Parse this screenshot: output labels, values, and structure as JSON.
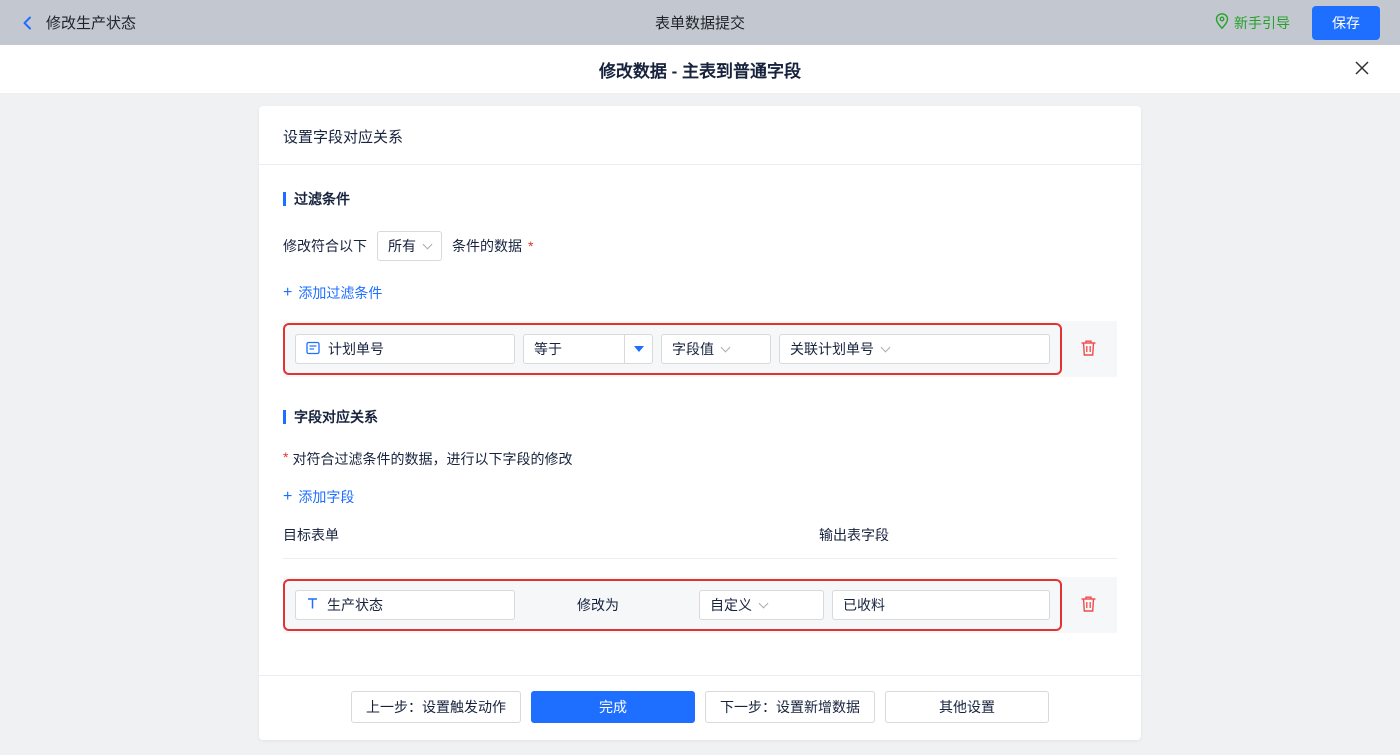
{
  "icons": {
    "plus": "+",
    "required": "*"
  },
  "topbar": {
    "back_label": "修改生产状态",
    "title": "表单数据提交",
    "guide": "新手引导",
    "save": "保存"
  },
  "dialog": {
    "title": "修改数据 - 主表到普通字段"
  },
  "panel": {
    "header": "设置字段对应关系",
    "filter": {
      "title": "过滤条件",
      "prefix": "修改符合以下",
      "match_mode": "所有",
      "suffix": "条件的数据",
      "add": "添加过滤条件",
      "row": {
        "field": "计划单号",
        "operator": "等于",
        "value_type": "字段值",
        "value": "关联计划单号"
      }
    },
    "mapping": {
      "title": "字段对应关系",
      "hint": "对符合过滤条件的数据，进行以下字段的修改",
      "add": "添加字段",
      "columns": {
        "target": "目标表单",
        "output": "输出表字段"
      },
      "row": {
        "field": "生产状态",
        "action": "修改为",
        "mode": "自定义",
        "value": "已收料"
      }
    },
    "footer": {
      "prev": "上一步：设置触发动作",
      "done": "完成",
      "next": "下一步：设置新增数据",
      "other": "其他设置"
    }
  },
  "colors": {
    "accent": "#1e6fff",
    "danger": "#e23333",
    "success": "#26a12b",
    "topbar_bg": "#c3c7d0"
  }
}
